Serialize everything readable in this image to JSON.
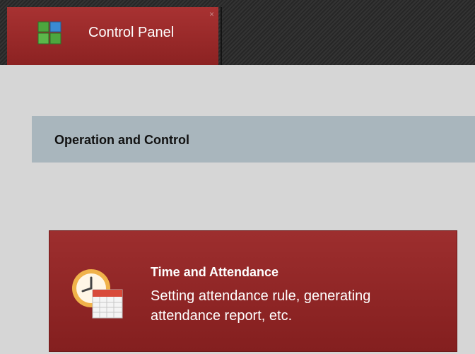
{
  "header": {
    "tab_label": "Control Panel",
    "tab_close_glyph": "×",
    "tab_icon": "grid-icon"
  },
  "section": {
    "title": "Operation and Control"
  },
  "cards": [
    {
      "title": "Time and Attendance",
      "description": "Setting attendance rule, generating attendance report, etc.",
      "icon": "clock-calendar-icon"
    }
  ],
  "colors": {
    "tab_red": "#a83232",
    "card_red": "#9d2e2e",
    "section_bg": "#a9b6bd",
    "page_bg": "#d6d6d6",
    "topbar_bg": "#2c2c2c"
  }
}
